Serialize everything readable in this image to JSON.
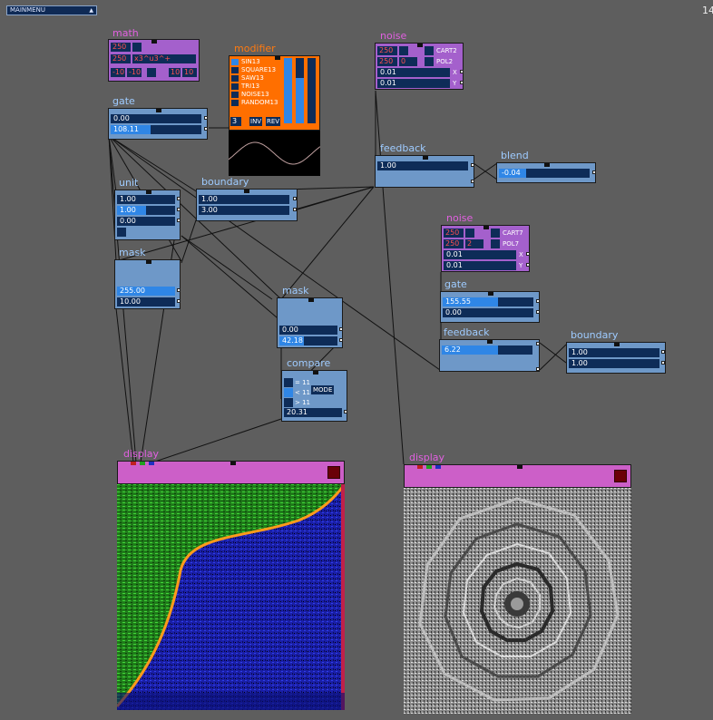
{
  "menu": {
    "label": "MAINMENU",
    "arrow": "▲"
  },
  "counter": "14",
  "math": {
    "title": "math",
    "r1a": "250",
    "r2a": "250",
    "r2b": "x3^u3^+",
    "r3a": "-10",
    "r3b": "-10",
    "r3c": "10",
    "r3d": "10"
  },
  "modifier": {
    "title": "modifier",
    "items": [
      "SIN13",
      "SQUARE13",
      "SAW13",
      "TRI13",
      "NOISE13",
      "RANDOM13"
    ],
    "selected_index": 0,
    "num": "3",
    "inv": "INV",
    "rev": "REV"
  },
  "noise1": {
    "title": "noise",
    "a1": "250",
    "a2": "250",
    "b2": "0",
    "cart": "CART2",
    "pol": "POL2",
    "x_val": "0.01",
    "y_val": "0.01",
    "x_lbl": "X",
    "y_lbl": "Y"
  },
  "gate1": {
    "title": "gate",
    "v1": "0.00",
    "v2": "108.11"
  },
  "feedback1": {
    "title": "feedback",
    "v1": "1.00"
  },
  "blend": {
    "title": "blend",
    "v1": "-0.04"
  },
  "unit": {
    "title": "unit",
    "v1": "1.00",
    "v2": "1.00",
    "v3": "0.00"
  },
  "boundary1": {
    "title": "boundary",
    "v1": "1.00",
    "v2": "3.00"
  },
  "noise2": {
    "title": "noise",
    "a1": "250",
    "a2": "250",
    "b2": "2",
    "cart": "CART7",
    "pol": "POL7",
    "x_val": "0.01",
    "y_val": "0.01",
    "x_lbl": "X",
    "y_lbl": "Y"
  },
  "mask1": {
    "title": "mask",
    "v1": "255.00",
    "v2": "10.00"
  },
  "gate2": {
    "title": "gate",
    "v1": "155.55",
    "v2": "0.00"
  },
  "mask2": {
    "title": "mask",
    "v1": "0.00",
    "v2": "42.18"
  },
  "feedback2": {
    "title": "feedback",
    "v1": "6.22"
  },
  "boundary2": {
    "title": "boundary",
    "v1": "1.00",
    "v2": "1.00"
  },
  "compare": {
    "title": "compare",
    "eq": "= 11",
    "lt": "< 11",
    "gt": "> 11",
    "mode": "MODE",
    "val": "20.31"
  },
  "display1": {
    "title": "display"
  },
  "display2": {
    "title": "display"
  },
  "colors": {
    "node": "#6e98c8",
    "purple": "#a460cc",
    "orange": "#ff6f00",
    "magenta": "#cc5fc8",
    "slider_bg": "#0e2c58",
    "slider_fill": "#2f86e6",
    "wire": "#111111"
  }
}
